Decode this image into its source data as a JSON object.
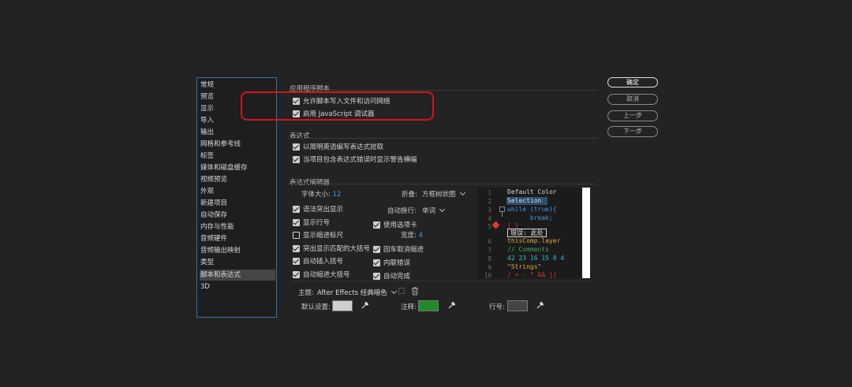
{
  "nav": {
    "items": [
      "常规",
      "预览",
      "显示",
      "导入",
      "输出",
      "网格和参考线",
      "标签",
      "媒体和磁盘缓存",
      "视频预览",
      "外观",
      "新建项目",
      "自动保存",
      "内存与性能",
      "音频硬件",
      "音频输出映射",
      "类型",
      "脚本和表达式",
      "3D"
    ],
    "selected_index": 16
  },
  "app_scripts": {
    "title": "应用程序脚本",
    "opt1": "允许脚本写入文件和访问网络",
    "opt2": "启用 JavaScript 调试器"
  },
  "expressions": {
    "title": "表达式",
    "opt1": "以简明英语编写表达式拾取",
    "opt2": "当项目包含表达式错误时显示警告横幅"
  },
  "editor": {
    "title": "表达式编辑器",
    "font_size_label": "字体大小:",
    "font_size_value": "12",
    "fold_label": "折叠:",
    "fold_value": "方框树状图",
    "syntax_highlight": "语法突出显示",
    "word_wrap_label": "自动换行:",
    "word_wrap_value": "单词",
    "show_line_numbers": "显示行号",
    "use_tabs": "使用选项卡",
    "show_indent_guides": "显示缩进标尺",
    "width_label": "宽度:",
    "width_value": "4",
    "highlight_brackets": "突出显示匹配的大括号",
    "return_unindent": "回车取消缩进",
    "auto_insert_brackets": "自动插入括号",
    "inline_errors": "内联错误",
    "auto_indent_braces": "自动缩进大括号",
    "autocomplete": "自动完成"
  },
  "code_preview": {
    "line_numbers": [
      "1",
      "2",
      "3",
      "4",
      "5",
      "6",
      "7",
      "8",
      "9",
      "10"
    ],
    "lines": [
      {
        "text": "Default Color",
        "color": "#d8d8d8"
      },
      {
        "text": "Selection",
        "color": "#d8d8d8"
      },
      {
        "text": "while (true){",
        "color": "#3e96e8"
      },
      {
        "text": "      break;",
        "color": "#3e96e8"
      },
      {
        "text": "[ ]",
        "color": "#d93a3a"
      },
      {
        "text": "thisComp.layer",
        "color": "#e0a83a"
      },
      {
        "text": "// Comments",
        "color": "#3aa55a"
      },
      {
        "text": "42 23 16 15 8 4",
        "color": "#3ab5d8"
      },
      {
        "text": "\"Strings\"",
        "color": "#e0a83a"
      },
      {
        "text": "/ + - * && ||",
        "color": "#d93a3a"
      }
    ],
    "error_text": "错误: 此处"
  },
  "theme": {
    "label": "主题:",
    "value": "After Effects 经典暗色",
    "default_label": "默认设置:",
    "default_color": "#cfcfcf",
    "comment_label": "注释:",
    "comment_color": "#1f8a2a",
    "line_no_label": "行号:",
    "line_no_color": "#444444"
  },
  "buttons": {
    "ok": "确定",
    "cancel": "取消",
    "prev": "上一步",
    "next": "下一步"
  },
  "colors": {
    "accent": "#3e96e8",
    "highlight_ring": "#d2141a"
  }
}
